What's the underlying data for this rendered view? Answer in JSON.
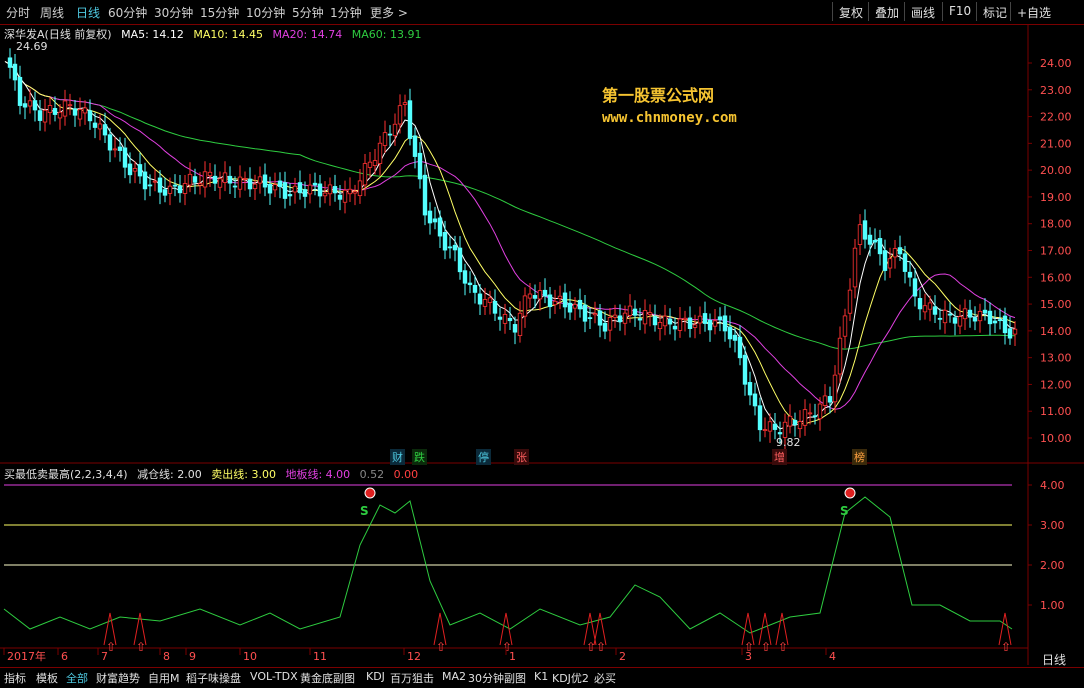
{
  "toolbar": {
    "periods": [
      "分时",
      "周线",
      "日线",
      "60分钟",
      "30分钟",
      "15分钟",
      "10分钟",
      "5分钟",
      "1分钟",
      "更多 >"
    ],
    "active_period": "日线",
    "right_buttons": [
      "复权",
      "叠加",
      "画线",
      "F10",
      "标记",
      "+自选"
    ]
  },
  "main_legend": {
    "name": "深华发A(日线 前复权)",
    "ma5": "MA5: 14.12",
    "ma10": "MA10: 14.45",
    "ma20": "MA20: 14.74",
    "ma60": "MA60: 13.91",
    "colors": {
      "ma5": "#ffffff",
      "ma10": "#ffff66",
      "ma20": "#e040e0",
      "ma60": "#2ecc40"
    }
  },
  "price_axis": [
    "24.00",
    "23.00",
    "22.00",
    "21.00",
    "20.00",
    "19.00",
    "18.00",
    "17.00",
    "16.00",
    "15.00",
    "14.00",
    "13.00",
    "12.00",
    "11.00",
    "10.00"
  ],
  "annotations": {
    "high": "24.69",
    "low": "9.82"
  },
  "event_tags": [
    "财",
    "跌",
    "停",
    "张",
    "增",
    "榜"
  ],
  "watermark": {
    "line1": "第一股票公式网",
    "line2": "www.chnmoney.com"
  },
  "indicator_legend": {
    "name": "买最低卖最高(2,2,3,4,4)",
    "reduce": "减仓线: 2.00",
    "sell": "卖出线: 3.00",
    "floor": "地板线: 4.00",
    "extra": "0.52",
    "extra2": "0.00"
  },
  "indicator_axis": [
    "4.00",
    "3.00",
    "2.00",
    "1.00"
  ],
  "sell_marker": "S",
  "time_axis": [
    "2017年",
    "6",
    "7",
    "8",
    "9",
    "10",
    "11",
    "12",
    "1",
    "2",
    "3",
    "4"
  ],
  "bottom_tabs": [
    "指标",
    "模板",
    "全部",
    "财富趋势",
    "自用M",
    "稻子味操盘",
    "VOL-TDX",
    "黄金底副图",
    "KDJ",
    "百万狙击",
    "MA2",
    "30分钟副图",
    "K1",
    "KDJ优2",
    "必买"
  ],
  "active_tab": "全部",
  "period_label": "日线"
}
